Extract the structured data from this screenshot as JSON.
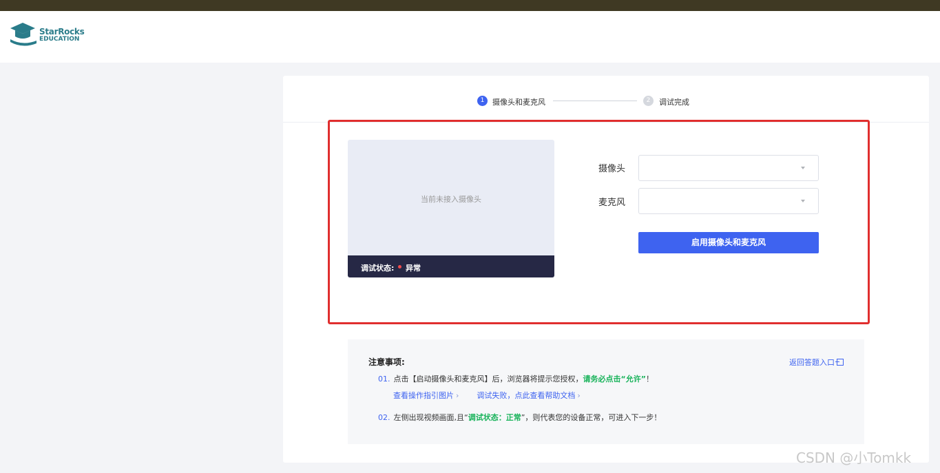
{
  "logo": {
    "line1": "StarRocks",
    "line2": "EDUCATION"
  },
  "steps": [
    {
      "num": "1",
      "label": "摄像头和麦克风"
    },
    {
      "num": "2",
      "label": "调试完成"
    }
  ],
  "video": {
    "placeholder": "当前未接入摄像头",
    "status_label": "调试状态:",
    "status_value": "异常"
  },
  "form": {
    "camera_label": "摄像头",
    "camera_value": "",
    "mic_label": "麦克风",
    "mic_value": "",
    "enable_button": "启用摄像头和麦克风"
  },
  "notes": {
    "title": "注意事项:",
    "back_link": "返回答题入口",
    "item1_num": "01.",
    "item1_text_a": "点击【启动摄像头和麦克风】后，浏览器将提示您授权，",
    "item1_text_b": "请务必点击“允许”",
    "item1_text_c": "！",
    "link_guide": "查看操作指引图片",
    "link_help": "调试失败，点此查看帮助文档",
    "item2_num": "02.",
    "item2_text_a": "左侧出现视频画面,且“",
    "item2_text_b": "调试状态：正常",
    "item2_text_c": "”，则代表您的设备正常，可进入下一步！"
  },
  "watermark": "CSDN @小Tomkk",
  "colors": {
    "primary": "#3e63f0",
    "highlight_border": "#e02e2e",
    "status_error": "#f04c4c",
    "success_text": "#19b35b",
    "topbar": "#3f3923"
  }
}
